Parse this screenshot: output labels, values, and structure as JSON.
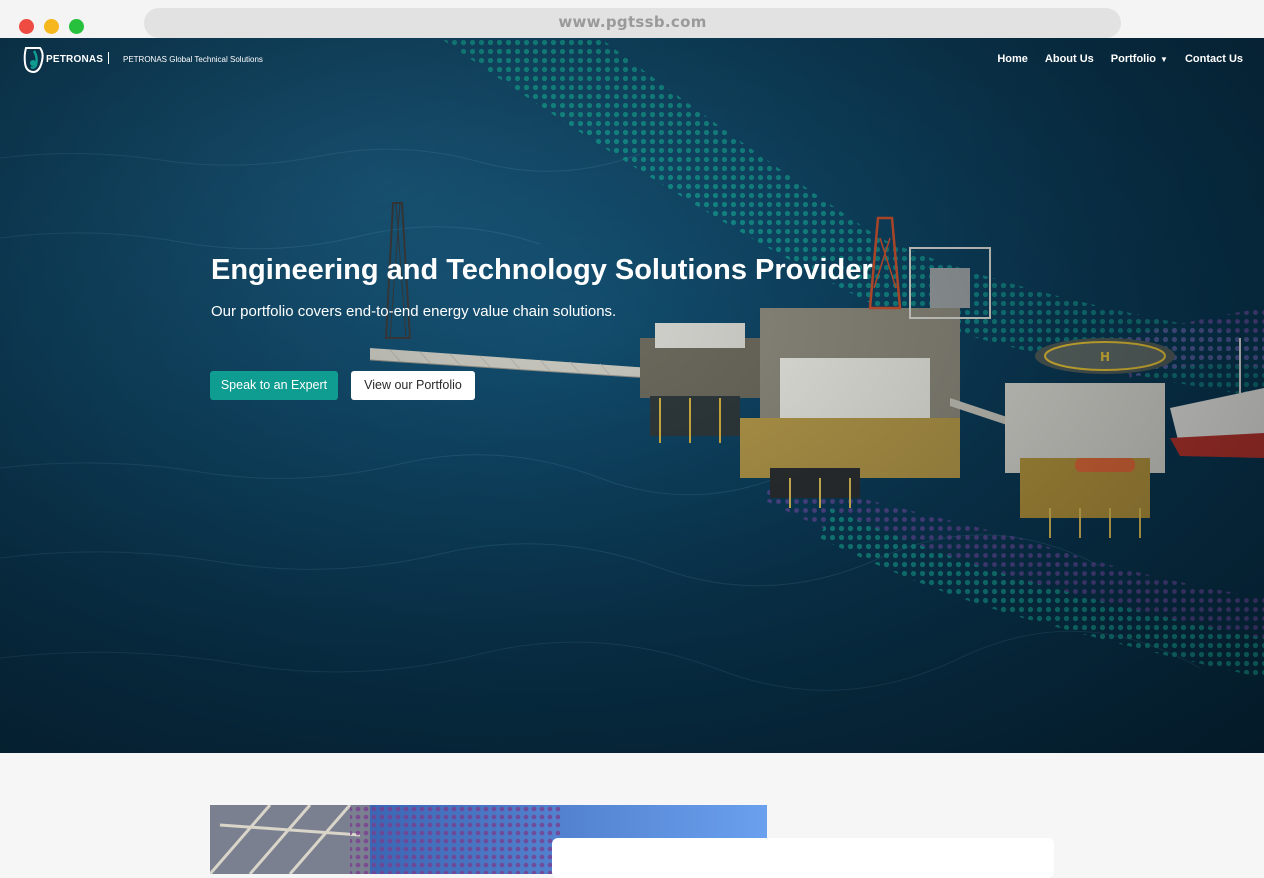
{
  "browser": {
    "url": "www.pgtssb.com"
  },
  "nav": {
    "brand": "PETRONAS",
    "brand_sub": "PETRONAS Global Technical Solutions",
    "links": [
      {
        "label": "Home"
      },
      {
        "label": "About Us"
      },
      {
        "label": "Portfolio",
        "has_dropdown": true
      },
      {
        "label": "Contact Us"
      }
    ]
  },
  "hero": {
    "title": "Engineering and Technology Solutions Provider",
    "subtitle": "Our portfolio covers end-to-end energy value chain solutions.",
    "primary_button": "Speak to an Expert",
    "secondary_button": "View our Portfolio"
  },
  "colors": {
    "accent": "#0f9c91",
    "ocean": "#0a3a57",
    "page_bg": "#f6f6f6"
  }
}
